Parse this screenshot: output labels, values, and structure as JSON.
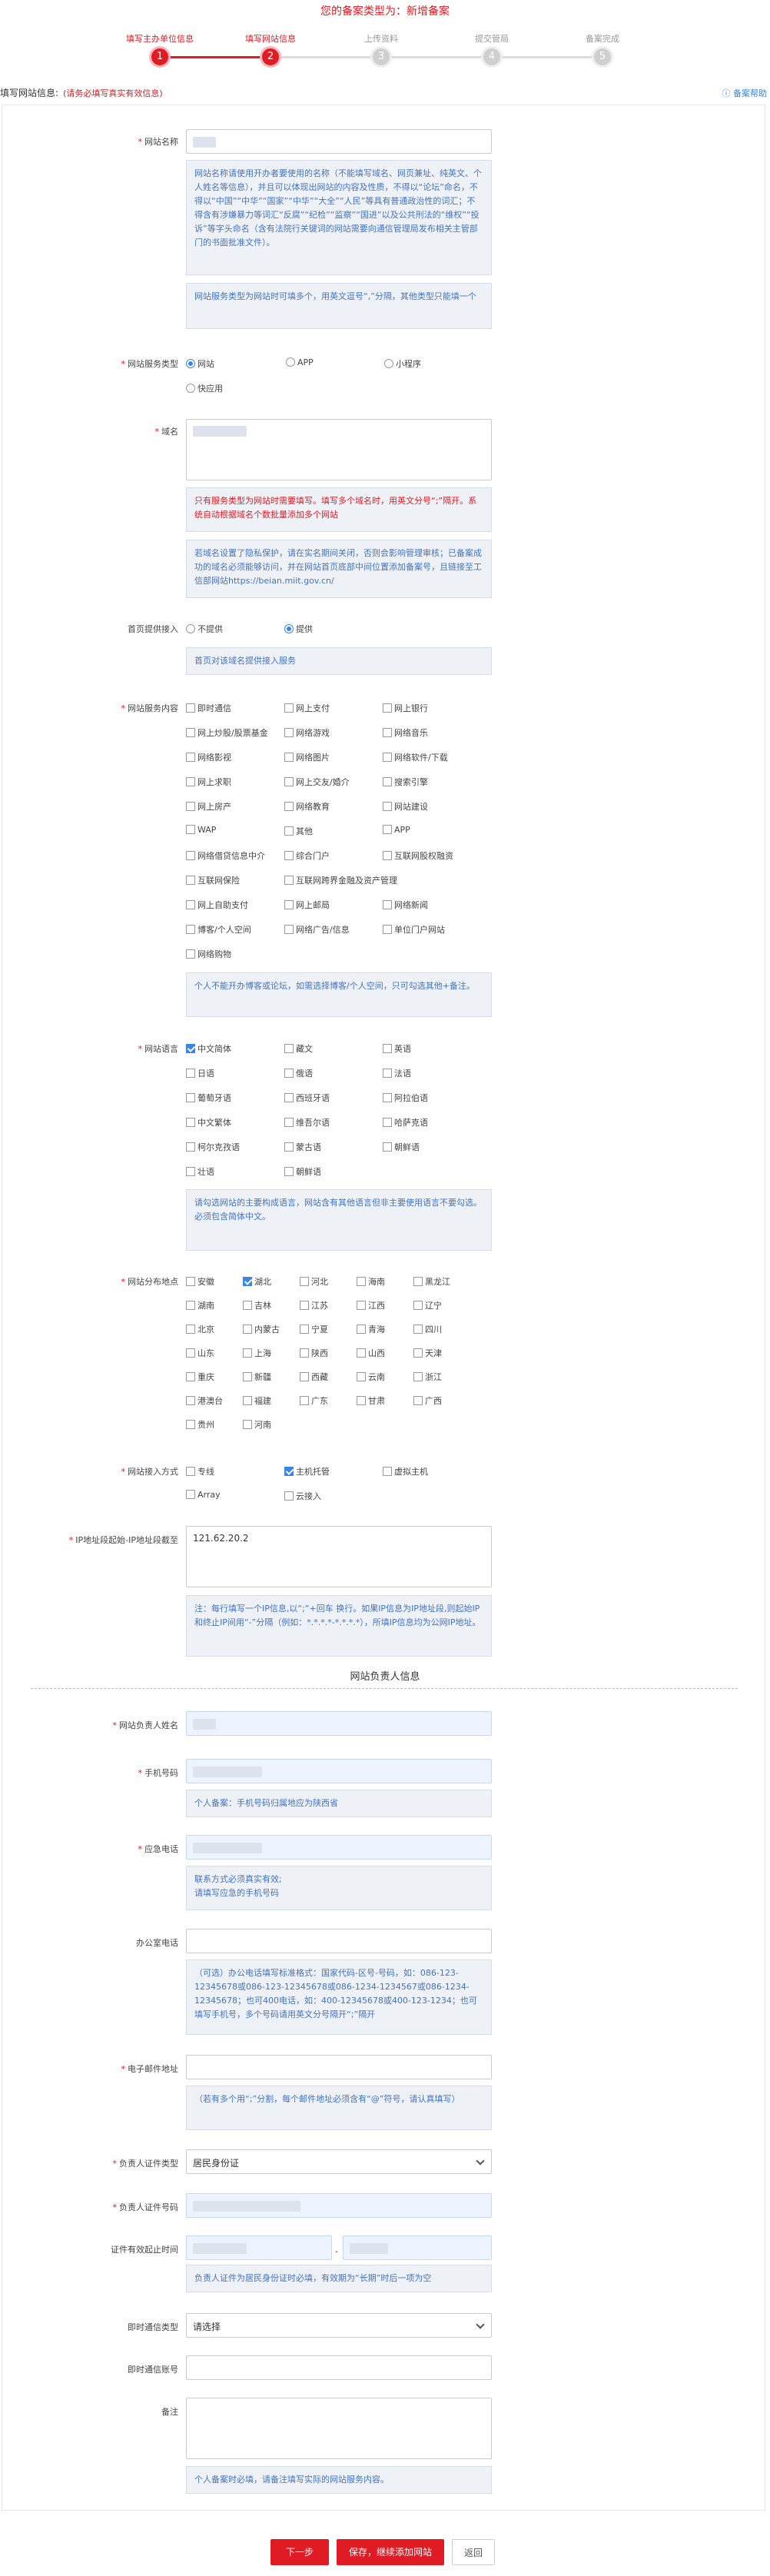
{
  "header": {
    "title": "您的备案类型为：新增备案"
  },
  "steps": [
    {
      "num": "1",
      "label": "填写主办单位信息",
      "state": "done"
    },
    {
      "num": "2",
      "label": "填写网站信息",
      "state": "active"
    },
    {
      "num": "3",
      "label": "上传资料",
      "state": "todo"
    },
    {
      "num": "4",
      "label": "提交管局",
      "state": "todo"
    },
    {
      "num": "5",
      "label": "备案完成",
      "state": "todo"
    }
  ],
  "page": {
    "heading": "填写网站信息:",
    "warning": "(请务必填写真实有效信息)",
    "help": "备案帮助"
  },
  "site_name": {
    "label": "网站名称",
    "hint1": "网站名称请使用开办者要使用的名称（不能填写域名、网页兼址、纯英文、个人姓名等信息），并且可以体现出网站的内容及性质，不得以“论坛”命名，不得以“中国”“中华”“国家”“中华”“大全”“人民”等具有普通政治性的词汇；不得含有涉嫌暴力等词汇“反腐”“纪检”“监察”“国进”以及公共刑法的“维权”“投诉”等字头命名（含有法院行关键词的网站需要向通信管理局发布相关主管部门的书面批准文件）。",
    "hint2": "网站服务类型为网站时可填多个，用英文逗号“,”分隔，其他类型只能填一个"
  },
  "service_type": {
    "label": "网站服务类型",
    "options": [
      "网站",
      "APP",
      "小程序",
      "快应用"
    ],
    "selected": "网站"
  },
  "domain": {
    "label": "域名",
    "hint_red": "只有服务类型为网站时需要填写。填写多个域名时，用英文分号“;”隔开。系统自动根据域名个数批量添加多个网站",
    "hint_blue": "若域名设置了隐私保护，请在实名期间关闭，否则会影响管理审核；已备案成功的域名必须能够访问，并在网站首页底部中间位置添加备案号，且链接至工信部网站https://beian.miit.gov.cn/"
  },
  "access": {
    "label": "首页提供接入",
    "options": [
      "不提供",
      "提供"
    ],
    "selected": "提供",
    "hint": "首页对该域名提供接入服务"
  },
  "content": {
    "label": "网站服务内容",
    "options": [
      "即时通信",
      "网上支付",
      "网上银行",
      "网上炒股/股票基金",
      "网络游戏",
      "网络音乐",
      "网络影视",
      "网络图片",
      "网络软件/下载",
      "网上求职",
      "网上交友/婚介",
      "搜索引擎",
      "网上房产",
      "网络教育",
      "网站建设",
      "WAP",
      "其他",
      "APP",
      "网络借贷信息中介",
      "综合门户",
      "互联网股权融资",
      "互联网保险",
      "互联网跨界金融及资产管理",
      "",
      "网上自助支付",
      "网上邮局",
      "网络新闻",
      "博客/个人空间",
      "网络广告/信息",
      "单位门户网站",
      "网络购物"
    ],
    "checked": [],
    "hint": "个人不能开办博客或论坛，如需选择博客/个人空间，只可勾选其他+备注。"
  },
  "language": {
    "label": "网站语言",
    "options": [
      "中文简体",
      "藏文",
      "英语",
      "日语",
      "俄语",
      "法语",
      "葡萄牙语",
      "西班牙语",
      "阿拉伯语",
      "中文繁体",
      "维吾尔语",
      "哈萨克语",
      "柯尔克孜语",
      "蒙古语",
      "朝鲜语",
      "壮语",
      "朝鲜语"
    ],
    "checked": [
      "中文简体"
    ],
    "hint": "请勾选网站的主要构成语言，网站含有其他语言但非主要使用语言不要勾选。\n必须包含简体中文。"
  },
  "region": {
    "label": "网站分布地点",
    "options": [
      "安徽",
      "湖北",
      "河北",
      "海南",
      "黑龙江",
      "湖南",
      "吉林",
      "江苏",
      "江西",
      "辽宁",
      "北京",
      "内蒙古",
      "宁夏",
      "青海",
      "四川",
      "山东",
      "上海",
      "陕西",
      "山西",
      "天津",
      "重庆",
      "新疆",
      "西藏",
      "云南",
      "浙江",
      "港澳台",
      "福建",
      "广东",
      "甘肃",
      "广西",
      "贵州",
      "河南"
    ],
    "checked": [
      "湖北"
    ]
  },
  "access_mode": {
    "label": "网站接入方式",
    "options": [
      "专线",
      "主机托管",
      "虚拟主机",
      "Array",
      "云接入"
    ],
    "checked": [
      "主机托管"
    ]
  },
  "ip": {
    "label": "IP地址段起始-IP地址段截至",
    "value": "121.62.20.2",
    "hint": "注：每行填写一个IP信息,以“;”+回车 换行。如果IP信息为IP地址段,则起始IP和终止IP间用“-”分隔（例如：*.*.*.*-*.*.*.*），所填IP信息均为公网IP地址。"
  },
  "section": {
    "title": "网站负责人信息"
  },
  "owner": {
    "name_label": "网站负责人姓名",
    "phone_label": "手机号码",
    "phone_hint": "个人备案：手机号码归属地应为陕西省",
    "emergency_label": "应急电话",
    "emergency_hint": "联系方式必须真实有效;\n请填写应急的手机号码",
    "office_label": "办公室电话",
    "office_hint": "（可选）办公电话填写标准格式：国家代码-区号-号码，如：086-123-12345678或086-123-12345678或086-1234-1234567或086-1234-12345678；也可400电话，如：400-12345678或400-123-1234；也可填写手机号，多个号码请用英文分号隔开“;”隔开",
    "email_label": "电子邮件地址",
    "email_hint": "（若有多个用“;”分割，每个邮件地址必须含有“@”符号，请认真填写）",
    "idtype_label": "负责人证件类型",
    "idtype_value": "居民身份证",
    "idno_label": "负责人证件号码",
    "valid_label": "证件有效起止时间",
    "valid_hint": "负责人证件为居民身份证时必填，有效期为“长期”时后一项为空",
    "im_type_label": "即时通信类型",
    "im_type_value": "请选择",
    "im_no_label": "即时通信账号",
    "remark_label": "备注",
    "remark_hint": "个人备案时必填，请备注填写实际的网站服务内容。"
  },
  "buttons": {
    "prev": "下一步",
    "save": "保存，继续添加网站",
    "back": "返回"
  },
  "colors": {
    "accent": "#e01b24",
    "link": "#3a86e6",
    "hint_bg": "#eef2f7"
  }
}
